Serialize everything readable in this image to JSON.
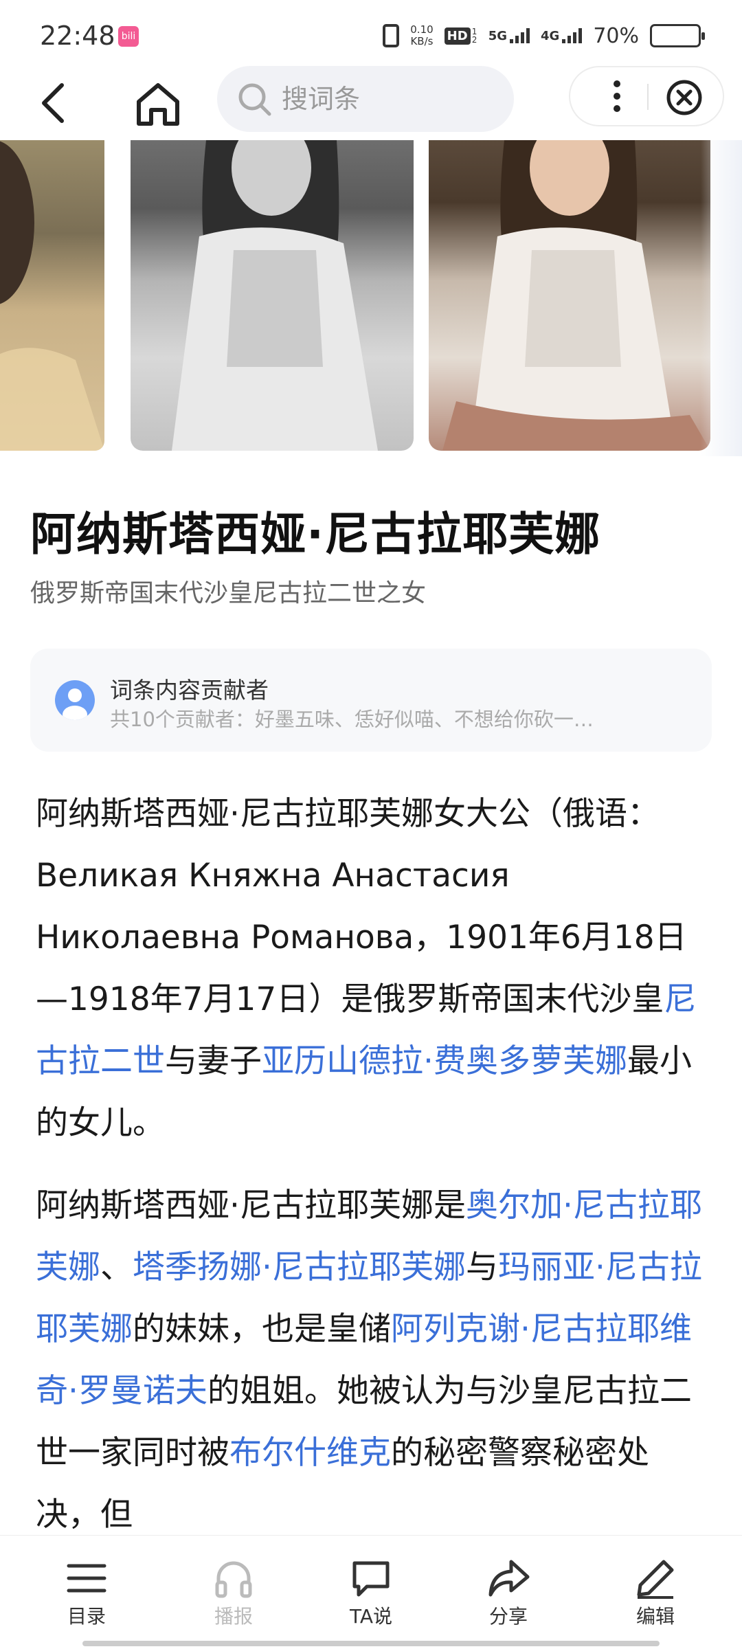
{
  "status_bar": {
    "time": "22:48",
    "app_icon_text": "bili",
    "net_speed_value": "0.10",
    "net_speed_unit": "KB/s",
    "hd_badge": "HD",
    "hd_sub": "1 2",
    "net_type_1": "5G",
    "net_type_2": "4G",
    "battery_percent": "70%",
    "battery_level": 0.7,
    "battery_color": "#2837d6"
  },
  "header": {
    "search_placeholder": "搜词条",
    "icons": [
      "back-icon",
      "home-icon",
      "search-icon",
      "more-icon",
      "close-icon"
    ]
  },
  "article": {
    "title": "阿纳斯塔西娅·尼古拉耶芙娜",
    "subtitle": "俄罗斯帝国末代沙皇尼古拉二世之女",
    "contributors": {
      "label": "词条内容贡献者",
      "names": "共10个贡献者：好墨五味、恁好似喵、不想给你砍一…"
    },
    "p1": {
      "t1": "阿纳斯塔西娅·尼古拉耶芙娜女大公（俄语：Великая Княжна Анастасия Николаевна Романова，1901年6月18日—1918年7月17日）是俄罗斯帝国末代沙皇",
      "l1": "尼古拉二世",
      "t2": "与妻子",
      "l2": "亚历山德拉·费奥多萝芙娜",
      "t3": "最小的女儿。"
    },
    "p2": {
      "t1": "阿纳斯塔西娅·尼古拉耶芙娜是",
      "l1": "奥尔加·尼古拉耶芙娜",
      "t2": "、",
      "l2": "塔季扬娜·尼古拉耶芙娜",
      "t3": "与",
      "l3": "玛丽亚·尼古拉耶芙娜",
      "t4": "的妹妹，也是皇储",
      "l4": "阿列克谢·尼古拉耶维奇·罗曼诺夫",
      "t5": "的姐姐。她被认为与沙皇尼古拉二世一家同时被",
      "l5": "布尔什维克",
      "t6": "的秘密警察秘密处决，但"
    },
    "link_color": "#3a6fd8"
  },
  "bottom_bar": {
    "items": [
      {
        "label": "目录",
        "icon": "list-icon",
        "enabled": true
      },
      {
        "label": "播报",
        "icon": "headphones-icon",
        "enabled": false
      },
      {
        "label": "TA说",
        "icon": "comment-icon",
        "enabled": true
      },
      {
        "label": "分享",
        "icon": "share-icon",
        "enabled": true
      },
      {
        "label": "编辑",
        "icon": "edit-icon",
        "enabled": true
      }
    ]
  }
}
